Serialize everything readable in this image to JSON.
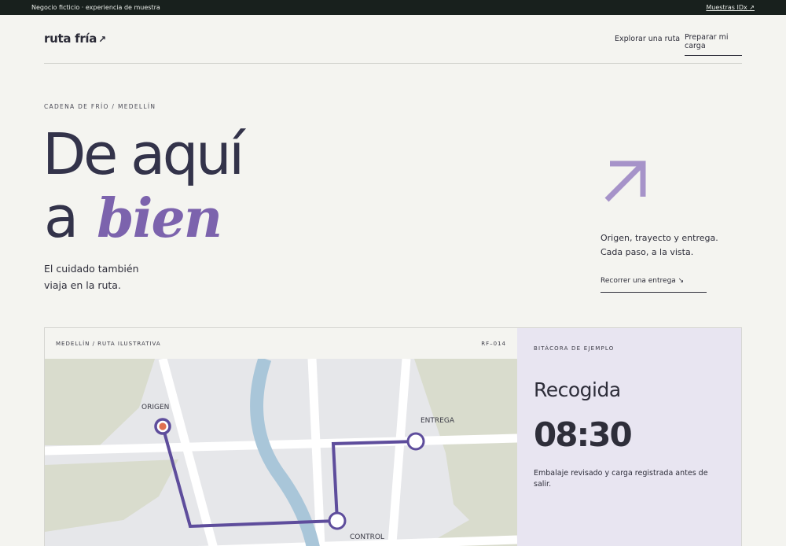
{
  "banner": {
    "left_text": "Negocio ficticio · experiencia de muestra",
    "right_link": "Muestras IDx ↗"
  },
  "header": {
    "logo_text": "ruta fría",
    "logo_arrow": "↗",
    "nav": {
      "explore": "Explorar una ruta",
      "prepare": "Preparar mi carga"
    }
  },
  "hero": {
    "eyebrow": "CADENA DE FRÍO / MEDELLÍN",
    "line1": "De aquí",
    "line2_a": "a",
    "line2_accent": "bien",
    "tagline_1": "El cuidado también",
    "tagline_2": "viaja en la ruta.",
    "side_text_1": "Origen, trayecto y entrega.",
    "side_text_2": "Cada paso, a la vista.",
    "side_link": "Recorrer una entrega ↘"
  },
  "map": {
    "header_left": "MEDELLÍN / RUTA ILUSTRATIVA",
    "header_right": "RF–014",
    "labels": {
      "origin": "ORIGEN",
      "delivery": "ENTREGA",
      "control": "CONTROL"
    }
  },
  "log": {
    "eyebrow": "BITÁCORA DE EJEMPLO",
    "status": "Recogida",
    "time": "08:30",
    "description": "Embalaje revisado y carga registrada antes de salir."
  },
  "colors": {
    "accent_purple": "#7c63ad",
    "route": "#5e4d9c",
    "origin_dot": "#e07050",
    "river": "#a9c6d9",
    "park": "#d9dccd",
    "map_bg": "#e6e7ea",
    "banner_bg": "#18201d",
    "log_bg": "#e8e5f1"
  }
}
